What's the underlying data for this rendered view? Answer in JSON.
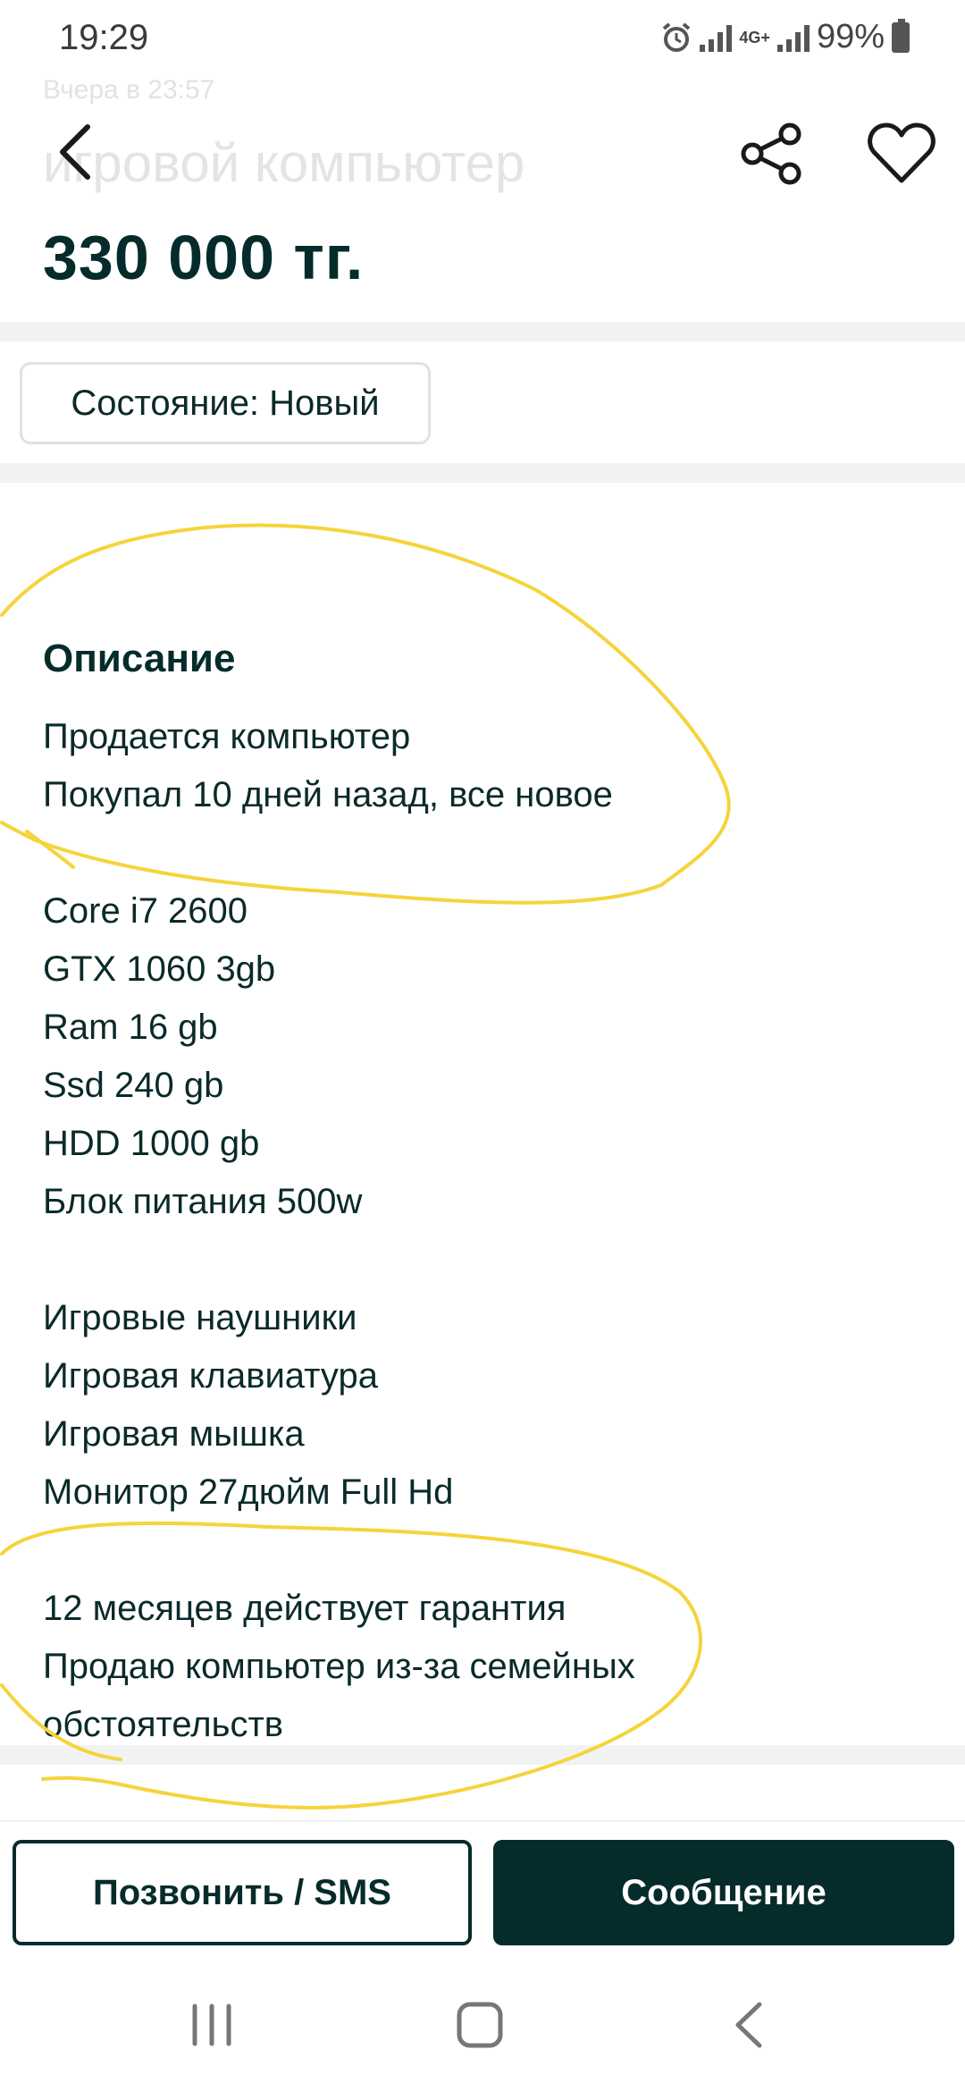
{
  "status_bar": {
    "time": "19:29",
    "network": "4G+",
    "battery": "99%"
  },
  "header": {
    "date": "Вчера в 23:57",
    "title": "игровой компьютер",
    "price": "330 000 тг."
  },
  "condition_chip": "Состояние: Новый",
  "description": {
    "title": "Описание",
    "lines": [
      "Продается компьютер",
      "Покупал 10 дней назад, все новое",
      "",
      "Core i7 2600",
      "GTX 1060 3gb",
      "Ram 16 gb",
      "Ssd 240 gb",
      "HDD 1000 gb",
      "Блок питания 500w",
      "",
      "Игровые наушники",
      "Игровая клавиатура",
      "Игровая мышка",
      "Монитор 27дюйм Full Hd",
      "",
      "12 месяцев действует гарантия",
      "Продаю компьютер из-за семейных",
      "обстоятельств"
    ]
  },
  "actions": {
    "call_label": "Позвонить / SMS",
    "message_label": "Сообщение"
  },
  "colors": {
    "brand_dark": "#062b2b",
    "highlight": "#f5d43c",
    "divider": "#f1f3f3"
  },
  "icons": [
    "back-arrow-icon",
    "share-icon",
    "heart-icon",
    "recent-apps-icon",
    "home-icon",
    "nav-back-icon"
  ]
}
